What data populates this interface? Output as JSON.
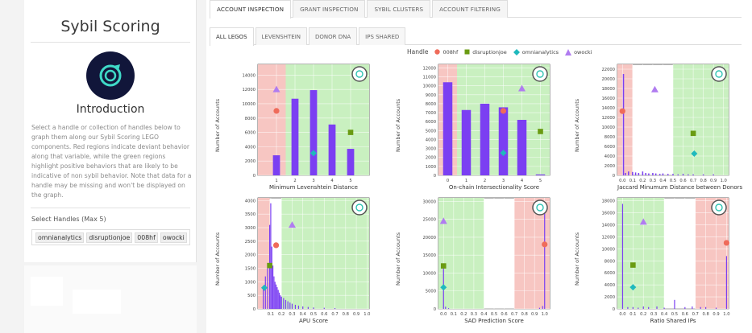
{
  "sidebar": {
    "title": "Sybil Scoring",
    "intro_heading": "Introduction",
    "description": "Select a handle or collection of handles below to graph them along our Sybil Scoring LEGO components. Red regions indicate deviant behavior along that variable, while the green regions highlight positive behaviors that are likely to be indicative of non sybil behavior. Note that data for a handle may be missing and won't be displayed on the graph.",
    "select_label": "Select Handles (Max 5)",
    "selected_handles": [
      "omnianalytics",
      "disruptionjoe",
      "008hf",
      "owocki"
    ]
  },
  "tabs": [
    "Account Inspection",
    "Grant Inspection",
    "Sybil Clusters",
    "Account Filtering"
  ],
  "subtabs": [
    "All Legos",
    "Levenshtein",
    "Donor DNA",
    "IPS Shared"
  ],
  "legend": {
    "title": "Handle",
    "items": [
      {
        "name": "008hf",
        "color": "#ef6b5a",
        "shape": "circle"
      },
      {
        "name": "disruptionjoe",
        "color": "#6a9b12",
        "shape": "square"
      },
      {
        "name": "omnianalytics",
        "color": "#1fb9bd",
        "shape": "diamond"
      },
      {
        "name": "owocki",
        "color": "#b07cf0",
        "shape": "triangle"
      }
    ]
  },
  "colors": {
    "bar": "#7b3ff2",
    "red_zone": "#f7c6c2",
    "green_zone": "#c9f0c0"
  },
  "chart_data": [
    {
      "type": "bar",
      "xlabel": "Minimum Levenshtein Distance",
      "ylabel": "Number of Accounts",
      "xlim": [
        0,
        6
      ],
      "ylim": [
        0,
        15500
      ],
      "xticks": [
        "1",
        "2",
        "3",
        "4",
        "5"
      ],
      "yticks": [
        0,
        2000,
        4000,
        6000,
        8000,
        10000,
        12000,
        14000
      ],
      "red_zone": [
        0,
        1.5
      ],
      "green_zone": [
        1.5,
        6
      ],
      "bars": [
        {
          "x": 1,
          "y": 2800
        },
        {
          "x": 2,
          "y": 10700
        },
        {
          "x": 3,
          "y": 11900
        },
        {
          "x": 4,
          "y": 7100
        },
        {
          "x": 5,
          "y": 3700
        }
      ],
      "bar_width": 0.38,
      "markers": [
        {
          "handle": "008hf",
          "x": 1,
          "y": 9000
        },
        {
          "handle": "owocki",
          "x": 1,
          "y": 12000
        },
        {
          "handle": "disruptionjoe",
          "x": 5,
          "y": 6000
        },
        {
          "handle": "omnianalytics",
          "x": 3,
          "y": 3100
        }
      ]
    },
    {
      "type": "bar",
      "xlabel": "On-chain Intersectionality Score",
      "ylabel": "Number of Accounts",
      "xlim": [
        -0.5,
        5.5
      ],
      "ylim": [
        0,
        12400
      ],
      "xticks": [
        "0",
        "1",
        "2",
        "3",
        "4",
        "5"
      ],
      "yticks": [
        0,
        1000,
        2000,
        3000,
        4000,
        5000,
        6000,
        7000,
        8000,
        9000,
        10000,
        11000,
        12000
      ],
      "red_zone": [
        -0.5,
        0.5
      ],
      "green_zone": [
        0.5,
        5.5
      ],
      "bars": [
        {
          "x": 0,
          "y": 10400
        },
        {
          "x": 1,
          "y": 7300
        },
        {
          "x": 2,
          "y": 8000
        },
        {
          "x": 3,
          "y": 7600
        },
        {
          "x": 4,
          "y": 6200
        },
        {
          "x": 5,
          "y": 100
        }
      ],
      "bar_width": 0.5,
      "markers": [
        {
          "handle": "008hf",
          "x": 3,
          "y": 7200
        },
        {
          "handle": "owocki",
          "x": 4,
          "y": 9700
        },
        {
          "handle": "disruptionjoe",
          "x": 5,
          "y": 4900
        },
        {
          "handle": "omnianalytics",
          "x": 3,
          "y": 2500
        }
      ]
    },
    {
      "type": "bar",
      "xlabel": "Jaccard Minumum Distance between Donors",
      "ylabel": "Number of Accounts",
      "xlim": [
        -0.05,
        1.05
      ],
      "ylim": [
        0,
        23000
      ],
      "xticks": [
        "0.0",
        "0.1",
        "0.2",
        "0.3",
        "0.4",
        "0.5",
        "0.6",
        "0.7",
        "0.8",
        "0.9",
        "1.0"
      ],
      "tick_values": [
        0,
        0.1,
        0.2,
        0.3,
        0.4,
        0.5,
        0.6,
        0.7,
        0.8,
        0.9,
        1.0
      ],
      "yticks": [
        0,
        2000,
        4000,
        6000,
        8000,
        10000,
        12000,
        14000,
        16000,
        18000,
        20000,
        22000
      ],
      "red_zone": [
        -0.05,
        0.1
      ],
      "green_zone": [
        0.5,
        1.05
      ],
      "bars": [
        {
          "x": 0.01,
          "y": 21000
        },
        {
          "x": 0.03,
          "y": 500
        },
        {
          "x": 0.06,
          "y": 800
        },
        {
          "x": 0.1,
          "y": 700
        },
        {
          "x": 0.13,
          "y": 600
        },
        {
          "x": 0.16,
          "y": 500
        },
        {
          "x": 0.2,
          "y": 800
        },
        {
          "x": 0.23,
          "y": 500
        },
        {
          "x": 0.26,
          "y": 400
        },
        {
          "x": 0.3,
          "y": 500
        },
        {
          "x": 0.33,
          "y": 400
        },
        {
          "x": 0.37,
          "y": 300
        },
        {
          "x": 0.4,
          "y": 400
        },
        {
          "x": 0.45,
          "y": 300
        },
        {
          "x": 0.5,
          "y": 300
        },
        {
          "x": 0.55,
          "y": 200
        },
        {
          "x": 0.6,
          "y": 300
        },
        {
          "x": 0.65,
          "y": 200
        },
        {
          "x": 0.7,
          "y": 200
        },
        {
          "x": 0.8,
          "y": 200
        },
        {
          "x": 0.9,
          "y": 200
        }
      ],
      "bar_width": 0.012,
      "markers": [
        {
          "handle": "008hf",
          "x": 0.0,
          "y": 13300
        },
        {
          "handle": "owocki",
          "x": 0.32,
          "y": 17800
        },
        {
          "handle": "disruptionjoe",
          "x": 0.7,
          "y": 8700
        },
        {
          "handle": "omnianalytics",
          "x": 0.71,
          "y": 4500
        }
      ]
    },
    {
      "type": "bar",
      "xlabel": "APU Score",
      "ylabel": "Number of Accounts",
      "xlim": [
        -0.02,
        1.02
      ],
      "ylim": [
        0,
        4100
      ],
      "xticks": [
        "0.1",
        "0.2",
        "0.3",
        "0.4",
        "0.5",
        "0.6",
        "0.7",
        "0.8",
        "0.9",
        "1.0"
      ],
      "tick_values": [
        0.1,
        0.2,
        0.3,
        0.4,
        0.5,
        0.6,
        0.7,
        0.8,
        0.9,
        1.0
      ],
      "yticks": [
        0,
        500,
        1000,
        1500,
        2000,
        2500,
        3000,
        3500,
        4000
      ],
      "red_zone": [
        -0.02,
        0.09
      ],
      "green_zone": [
        0.2,
        1.02
      ],
      "bars": [
        {
          "x": 0.03,
          "y": 800
        },
        {
          "x": 0.05,
          "y": 1200
        },
        {
          "x": 0.07,
          "y": 1500
        },
        {
          "x": 0.09,
          "y": 3100
        },
        {
          "x": 0.1,
          "y": 3900
        },
        {
          "x": 0.11,
          "y": 2300
        },
        {
          "x": 0.12,
          "y": 1600
        },
        {
          "x": 0.13,
          "y": 1200
        },
        {
          "x": 0.14,
          "y": 1000
        },
        {
          "x": 0.15,
          "y": 900
        },
        {
          "x": 0.16,
          "y": 800
        },
        {
          "x": 0.17,
          "y": 700
        },
        {
          "x": 0.18,
          "y": 600
        },
        {
          "x": 0.19,
          "y": 500
        },
        {
          "x": 0.2,
          "y": 450
        },
        {
          "x": 0.22,
          "y": 400
        },
        {
          "x": 0.24,
          "y": 330
        },
        {
          "x": 0.26,
          "y": 280
        },
        {
          "x": 0.28,
          "y": 230
        },
        {
          "x": 0.3,
          "y": 190
        },
        {
          "x": 0.33,
          "y": 150
        },
        {
          "x": 0.36,
          "y": 120
        },
        {
          "x": 0.4,
          "y": 90
        },
        {
          "x": 0.45,
          "y": 70
        },
        {
          "x": 0.5,
          "y": 50
        },
        {
          "x": 0.6,
          "y": 40
        },
        {
          "x": 0.7,
          "y": 30
        }
      ],
      "bar_width": 0.006,
      "markers": [
        {
          "handle": "008hf",
          "x": 0.15,
          "y": 2350
        },
        {
          "handle": "owocki",
          "x": 0.3,
          "y": 3100
        },
        {
          "handle": "disruptionjoe",
          "x": 0.09,
          "y": 1600
        },
        {
          "handle": "omnianalytics",
          "x": 0.04,
          "y": 780
        }
      ]
    },
    {
      "type": "bar",
      "xlabel": "SAD Prediction Score",
      "ylabel": "Number of Accounts",
      "xlim": [
        -0.05,
        1.05
      ],
      "ylim": [
        0,
        31000
      ],
      "xticks": [
        "0.0",
        "0.1",
        "0.2",
        "0.3",
        "0.4",
        "0.5",
        "0.6",
        "0.7",
        "0.8",
        "0.9",
        "1.0"
      ],
      "tick_values": [
        0,
        0.1,
        0.2,
        0.3,
        0.4,
        0.5,
        0.6,
        0.7,
        0.8,
        0.9,
        1.0
      ],
      "yticks": [
        0,
        5000,
        10000,
        15000,
        20000,
        25000,
        30000
      ],
      "red_zone": [
        0.7,
        1.05
      ],
      "green_zone": [
        -0.05,
        0.4
      ],
      "bars": [
        {
          "x": 0.0,
          "y": 11500
        },
        {
          "x": 0.02,
          "y": 600
        },
        {
          "x": 0.05,
          "y": 200
        },
        {
          "x": 0.95,
          "y": 300
        },
        {
          "x": 0.98,
          "y": 800
        },
        {
          "x": 1.0,
          "y": 27500
        }
      ],
      "bar_width": 0.008,
      "markers": [
        {
          "handle": "008hf",
          "x": 1.0,
          "y": 18000
        },
        {
          "handle": "owocki",
          "x": 0.0,
          "y": 24500
        },
        {
          "handle": "disruptionjoe",
          "x": 0.0,
          "y": 12000
        },
        {
          "handle": "omnianalytics",
          "x": 0.0,
          "y": 6000
        }
      ]
    },
    {
      "type": "bar",
      "xlabel": "Ratio Shared IPs",
      "ylabel": "Number of Accounts",
      "xlim": [
        -0.05,
        1.02
      ],
      "ylim": [
        0,
        18500
      ],
      "xticks": [
        "0.0",
        "0.1",
        "0.2",
        "0.3",
        "0.4",
        "0.5",
        "0.6",
        "0.7",
        "0.8",
        "0.9",
        "1.0"
      ],
      "tick_values": [
        0,
        0.1,
        0.2,
        0.3,
        0.4,
        0.5,
        0.6,
        0.7,
        0.8,
        0.9,
        1.0
      ],
      "yticks": [
        0,
        2000,
        4000,
        6000,
        8000,
        10000,
        12000,
        14000,
        16000,
        18000
      ],
      "red_zone": [
        0.7,
        1.02
      ],
      "green_zone": [
        -0.05,
        0.4
      ],
      "bars": [
        {
          "x": 0.0,
          "y": 17500
        },
        {
          "x": 0.05,
          "y": 300
        },
        {
          "x": 0.1,
          "y": 300
        },
        {
          "x": 0.15,
          "y": 200
        },
        {
          "x": 0.2,
          "y": 400
        },
        {
          "x": 0.25,
          "y": 300
        },
        {
          "x": 0.33,
          "y": 400
        },
        {
          "x": 0.4,
          "y": 200
        },
        {
          "x": 0.5,
          "y": 1500
        },
        {
          "x": 0.6,
          "y": 300
        },
        {
          "x": 0.67,
          "y": 400
        },
        {
          "x": 0.75,
          "y": 300
        },
        {
          "x": 0.8,
          "y": 300
        },
        {
          "x": 0.9,
          "y": 200
        },
        {
          "x": 1.0,
          "y": 8800
        }
      ],
      "bar_width": 0.008,
      "markers": [
        {
          "handle": "008hf",
          "x": 1.0,
          "y": 11000
        },
        {
          "handle": "owocki",
          "x": 0.2,
          "y": 14500
        },
        {
          "handle": "disruptionjoe",
          "x": 0.1,
          "y": 7300
        },
        {
          "handle": "omnianalytics",
          "x": 0.1,
          "y": 3600
        }
      ]
    }
  ]
}
